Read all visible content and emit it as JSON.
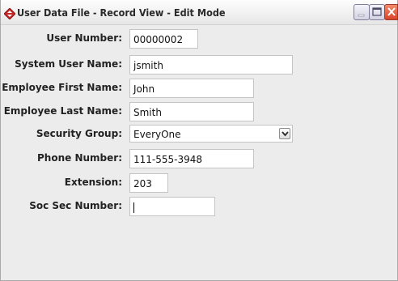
{
  "window": {
    "title": "User Data File - Record View - Edit Mode"
  },
  "icons": {
    "app": "app-diamond-icon",
    "minimize": "minimize-icon",
    "maximize": "maximize-icon",
    "close": "close-icon",
    "dropdown": "chevron-down-icon"
  },
  "form": {
    "user_number": {
      "label": "User Number:",
      "value": "00000002"
    },
    "system_user_name": {
      "label": "System User Name:",
      "value": "jsmith"
    },
    "first_name": {
      "label": "Employee First Name:",
      "value": "John"
    },
    "last_name": {
      "label": "Employee Last Name:",
      "value": "Smith"
    },
    "security_group": {
      "label": "Security Group:",
      "value": "EveryOne"
    },
    "phone_number": {
      "label": "Phone Number:",
      "value": "111-555-3948"
    },
    "extension": {
      "label": "Extension:",
      "value": "203"
    },
    "ssn": {
      "label": "Soc Sec Number:",
      "value": ""
    }
  },
  "colors": {
    "window_background": "#ececec",
    "close_button": "#d8442a"
  }
}
